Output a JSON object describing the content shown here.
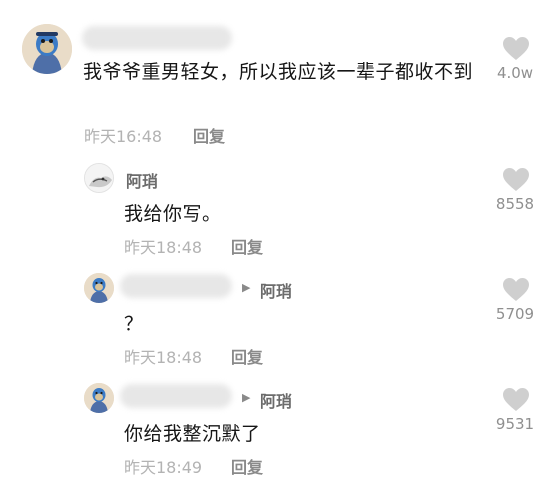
{
  "comments": {
    "main": {
      "text": "我爷爷重男轻女，所以我应该一辈子都收不到",
      "time": "昨天16:48",
      "reply_label": "回复",
      "likes": "4.0w"
    },
    "replies": [
      {
        "user": "阿琑",
        "text": "我给你写。",
        "time": "昨天18:48",
        "reply_label": "回复",
        "likes": "8558"
      },
      {
        "reply_to": "阿琑",
        "text": "？",
        "time": "昨天18:48",
        "reply_label": "回复",
        "likes": "5709"
      },
      {
        "reply_to": "阿琑",
        "text": "你给我整沉默了",
        "time": "昨天18:49",
        "reply_label": "回复",
        "likes": "9531"
      }
    ]
  },
  "icons": {
    "like": "heart-icon",
    "reply_arrow": "triangle-right-icon"
  },
  "colors": {
    "heart": "#cfcfcf",
    "meta": "#b3b3b3",
    "text": "#161616"
  }
}
